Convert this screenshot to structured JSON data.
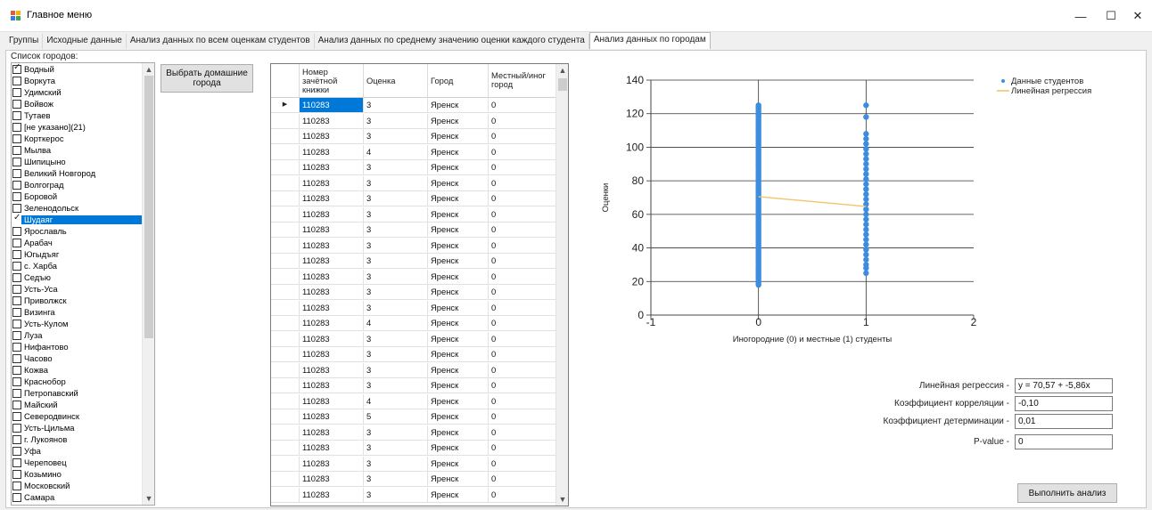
{
  "window": {
    "title": "Главное меню",
    "controls": {
      "minimize": "—",
      "maximize": "☐",
      "close": "✕"
    }
  },
  "tabs": [
    {
      "label": "Группы",
      "active": false
    },
    {
      "label": "Исходные данные",
      "active": false
    },
    {
      "label": "Анализ данных по всем оценкам студентов",
      "active": false
    },
    {
      "label": "Анализ данных по среднему значению оценки каждого студента",
      "active": false
    },
    {
      "label": "Анализ данных по городам",
      "active": true
    }
  ],
  "city_list": {
    "label": "Список городов:",
    "items": [
      {
        "label": "Водный",
        "checked": true,
        "selected": false
      },
      {
        "label": "Воркута",
        "checked": false,
        "selected": false
      },
      {
        "label": "Удимский",
        "checked": false,
        "selected": false
      },
      {
        "label": "Войвож",
        "checked": false,
        "selected": false
      },
      {
        "label": "Тутаев",
        "checked": false,
        "selected": false
      },
      {
        "label": "[не указано](21)",
        "checked": false,
        "selected": false
      },
      {
        "label": "Корткерос",
        "checked": false,
        "selected": false
      },
      {
        "label": "Мылва",
        "checked": false,
        "selected": false
      },
      {
        "label": "Шипицыно",
        "checked": false,
        "selected": false
      },
      {
        "label": "Великий Новгород",
        "checked": false,
        "selected": false
      },
      {
        "label": "Волгоград",
        "checked": false,
        "selected": false
      },
      {
        "label": "Боровой",
        "checked": false,
        "selected": false
      },
      {
        "label": "Зеленодольск",
        "checked": false,
        "selected": false
      },
      {
        "label": "Шудаяг",
        "checked": true,
        "selected": true
      },
      {
        "label": "Ярославль",
        "checked": false,
        "selected": false
      },
      {
        "label": "Арабач",
        "checked": false,
        "selected": false
      },
      {
        "label": "Югыдъяг",
        "checked": false,
        "selected": false
      },
      {
        "label": "с. Харба",
        "checked": false,
        "selected": false
      },
      {
        "label": "Седъю",
        "checked": false,
        "selected": false
      },
      {
        "label": "Усть-Уса",
        "checked": false,
        "selected": false
      },
      {
        "label": "Приволжск",
        "checked": false,
        "selected": false
      },
      {
        "label": "Визинга",
        "checked": false,
        "selected": false
      },
      {
        "label": "Усть-Кулом",
        "checked": false,
        "selected": false
      },
      {
        "label": "Луза",
        "checked": false,
        "selected": false
      },
      {
        "label": "Нифантово",
        "checked": false,
        "selected": false
      },
      {
        "label": "Часово",
        "checked": false,
        "selected": false
      },
      {
        "label": "Кожва",
        "checked": false,
        "selected": false
      },
      {
        "label": "Краснобор",
        "checked": false,
        "selected": false
      },
      {
        "label": "Петропавский",
        "checked": false,
        "selected": false
      },
      {
        "label": "Майский",
        "checked": false,
        "selected": false
      },
      {
        "label": "Северодвинск",
        "checked": false,
        "selected": false
      },
      {
        "label": "Усть-Цильма",
        "checked": false,
        "selected": false
      },
      {
        "label": "г. Лукоянов",
        "checked": false,
        "selected": false
      },
      {
        "label": "Уфа",
        "checked": false,
        "selected": false
      },
      {
        "label": "Череповец",
        "checked": false,
        "selected": false
      },
      {
        "label": "Козьмино",
        "checked": false,
        "selected": false
      },
      {
        "label": "Московский",
        "checked": false,
        "selected": false
      },
      {
        "label": "Самара",
        "checked": false,
        "selected": false
      }
    ]
  },
  "buttons": {
    "home_cities": "Выбрать домашние города",
    "run_analysis": "Выполнить анализ"
  },
  "grid": {
    "columns": [
      "Номер зачётной книжки",
      "Оценка",
      "Город",
      "Местный/иног город"
    ],
    "current_row_marker": "▶",
    "rows": [
      [
        "110283",
        "3",
        "Яренск",
        "0"
      ],
      [
        "110283",
        "3",
        "Яренск",
        "0"
      ],
      [
        "110283",
        "3",
        "Яренск",
        "0"
      ],
      [
        "110283",
        "4",
        "Яренск",
        "0"
      ],
      [
        "110283",
        "3",
        "Яренск",
        "0"
      ],
      [
        "110283",
        "3",
        "Яренск",
        "0"
      ],
      [
        "110283",
        "3",
        "Яренск",
        "0"
      ],
      [
        "110283",
        "3",
        "Яренск",
        "0"
      ],
      [
        "110283",
        "3",
        "Яренск",
        "0"
      ],
      [
        "110283",
        "3",
        "Яренск",
        "0"
      ],
      [
        "110283",
        "3",
        "Яренск",
        "0"
      ],
      [
        "110283",
        "3",
        "Яренск",
        "0"
      ],
      [
        "110283",
        "3",
        "Яренск",
        "0"
      ],
      [
        "110283",
        "3",
        "Яренск",
        "0"
      ],
      [
        "110283",
        "4",
        "Яренск",
        "0"
      ],
      [
        "110283",
        "3",
        "Яренск",
        "0"
      ],
      [
        "110283",
        "3",
        "Яренск",
        "0"
      ],
      [
        "110283",
        "3",
        "Яренск",
        "0"
      ],
      [
        "110283",
        "3",
        "Яренск",
        "0"
      ],
      [
        "110283",
        "4",
        "Яренск",
        "0"
      ],
      [
        "110283",
        "5",
        "Яренск",
        "0"
      ],
      [
        "110283",
        "3",
        "Яренск",
        "0"
      ],
      [
        "110283",
        "3",
        "Яренск",
        "0"
      ],
      [
        "110283",
        "3",
        "Яренск",
        "0"
      ],
      [
        "110283",
        "3",
        "Яренск",
        "0"
      ],
      [
        "110283",
        "3",
        "Яренск",
        "0"
      ]
    ]
  },
  "chart_data": {
    "type": "scatter",
    "xlabel": "Иногородние (0) и местные (1) студенты",
    "ylabel": "Оценки",
    "xlim": [
      -1,
      2
    ],
    "ylim": [
      0,
      140
    ],
    "x_ticks": [
      -1,
      0,
      1,
      2
    ],
    "y_ticks": [
      0,
      20,
      40,
      60,
      80,
      100,
      120,
      140
    ],
    "grid": true,
    "legend_position": "top-right",
    "point_color": "#3c8dde",
    "line_color": "#f2c46b",
    "series": [
      {
        "name": "Данные студентов",
        "kind": "points",
        "groups": [
          {
            "x": 0,
            "y_min": 18,
            "y_max": 125
          },
          {
            "x": 1,
            "y_values": [
              25,
              28,
              30,
              33,
              36,
              39,
              42,
              45,
              48,
              51,
              54,
              57,
              60,
              63,
              66,
              69,
              72,
              75,
              78,
              81,
              84,
              87,
              90,
              93,
              96,
              99,
              102,
              105,
              108,
              118,
              125
            ]
          }
        ]
      },
      {
        "name": "Линейная регрессия",
        "kind": "line",
        "x": [
          0,
          1
        ],
        "y": [
          70.57,
          64.71
        ]
      }
    ]
  },
  "stats": [
    {
      "label": "Линейная регрессия -",
      "value": "y = 70,57 + -5,86x"
    },
    {
      "label": "Коэффициент корреляции -",
      "value": "-0,10"
    },
    {
      "label": "Коэффициент детерминации -",
      "value": "0,01"
    },
    {
      "label": "P-value -",
      "value": "0"
    }
  ]
}
